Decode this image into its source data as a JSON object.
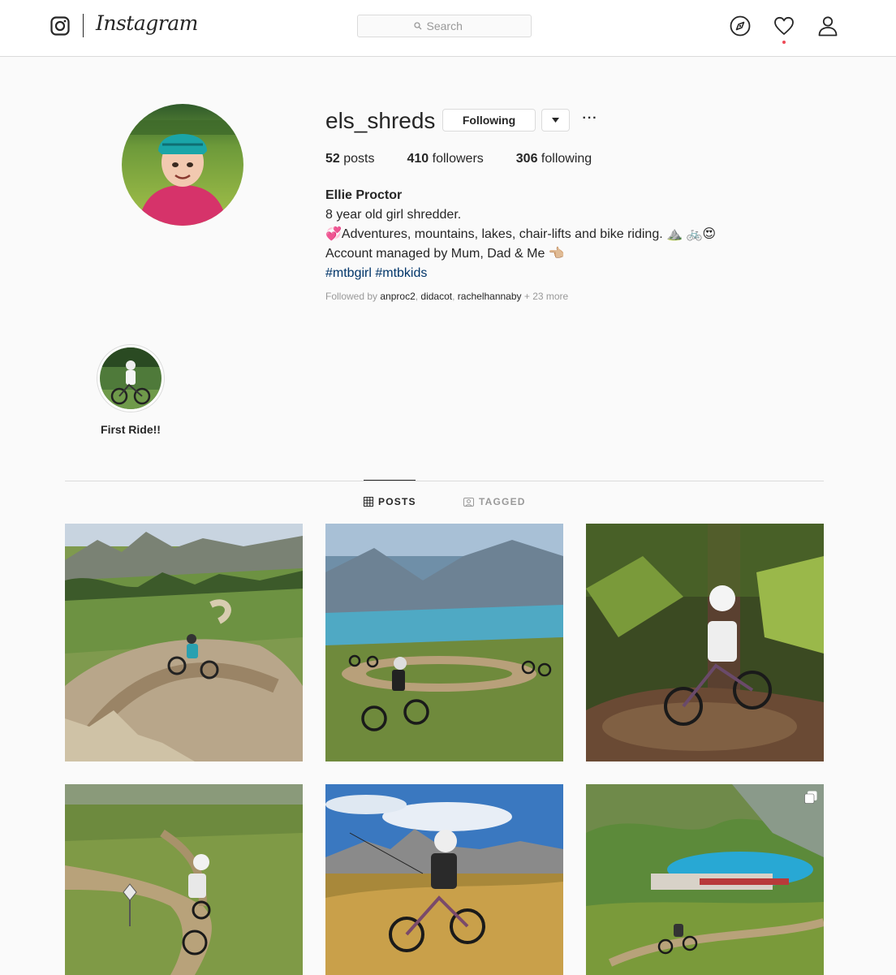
{
  "nav": {
    "wordmark": "Instagram",
    "search_placeholder": "Search",
    "icons": [
      "instagram-glyph-icon",
      "search-icon",
      "explore-icon",
      "heart-icon",
      "profile-icon"
    ],
    "has_notification": true
  },
  "profile": {
    "username": "els_shreds",
    "follow_label": "Following",
    "more_label": "···",
    "posts_count": "52",
    "posts_label": " posts",
    "followers_count": "410",
    "followers_label": " followers",
    "following_count": "306",
    "following_label": " following",
    "full_name": "Ellie Proctor",
    "bio_line1": "8 year old girl shredder.",
    "bio_line2": "💞Adventures, mountains, lakes, chair-lifts and bike riding. ⛰️ 🚲😍",
    "bio_line3": "Account managed by Mum, Dad & Me 👈🏼",
    "hashtag1": "#mtbgirl",
    "hashtag2": "#mtbkids",
    "followed_prefix": "Followed by ",
    "followed_user1": "anproc2",
    "followed_user2": "didacot",
    "followed_user3": "rachelhannaby",
    "followed_more": " + 23 more"
  },
  "highlights": [
    {
      "label": "First Ride!!"
    }
  ],
  "tabs": {
    "posts": "POSTS",
    "tagged": "TAGGED",
    "active": "posts"
  },
  "colors": {
    "link": "#003569",
    "border": "#dbdbdb",
    "background": "#fafafa",
    "notification": "#ed4956"
  }
}
